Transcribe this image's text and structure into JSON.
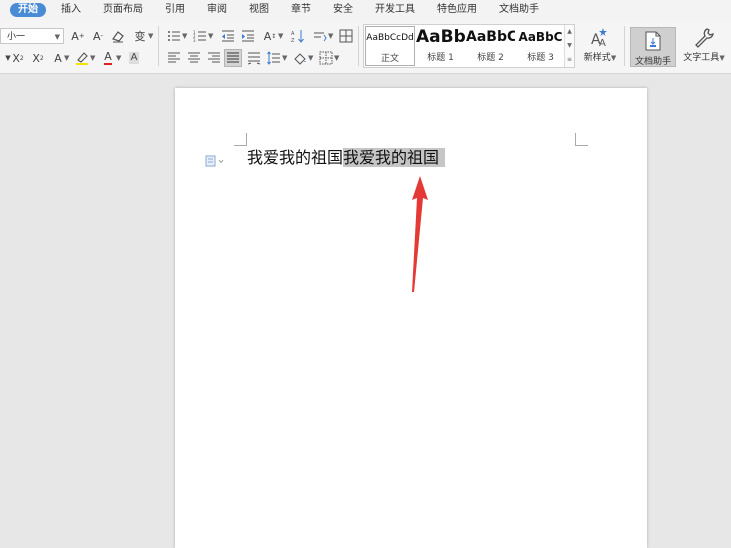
{
  "menu": {
    "tabs": [
      "开始",
      "插入",
      "页面布局",
      "引用",
      "审阅",
      "视图",
      "章节",
      "安全",
      "开发工具",
      "特色应用",
      "文档助手"
    ],
    "active_index": 0
  },
  "ribbon": {
    "font_size": "小一",
    "styles": [
      {
        "preview": "AaBbCcDd",
        "caption": "正文"
      },
      {
        "preview": "AaBb",
        "caption": "标题 1"
      },
      {
        "preview": "AaBbC",
        "caption": "标题 2"
      },
      {
        "preview": "AaBbC",
        "caption": "标题 3"
      }
    ],
    "new_style_label": "新样式",
    "doc_assistant_label": "文档助手",
    "text_tools_label": "文字工具"
  },
  "document": {
    "line_plain": "我爱我的祖国",
    "line_selected": "我爱我的祖国"
  },
  "colors": {
    "accent": "#4a8bd6",
    "selection": "#c6c6c6",
    "arrow": "#e53935"
  }
}
